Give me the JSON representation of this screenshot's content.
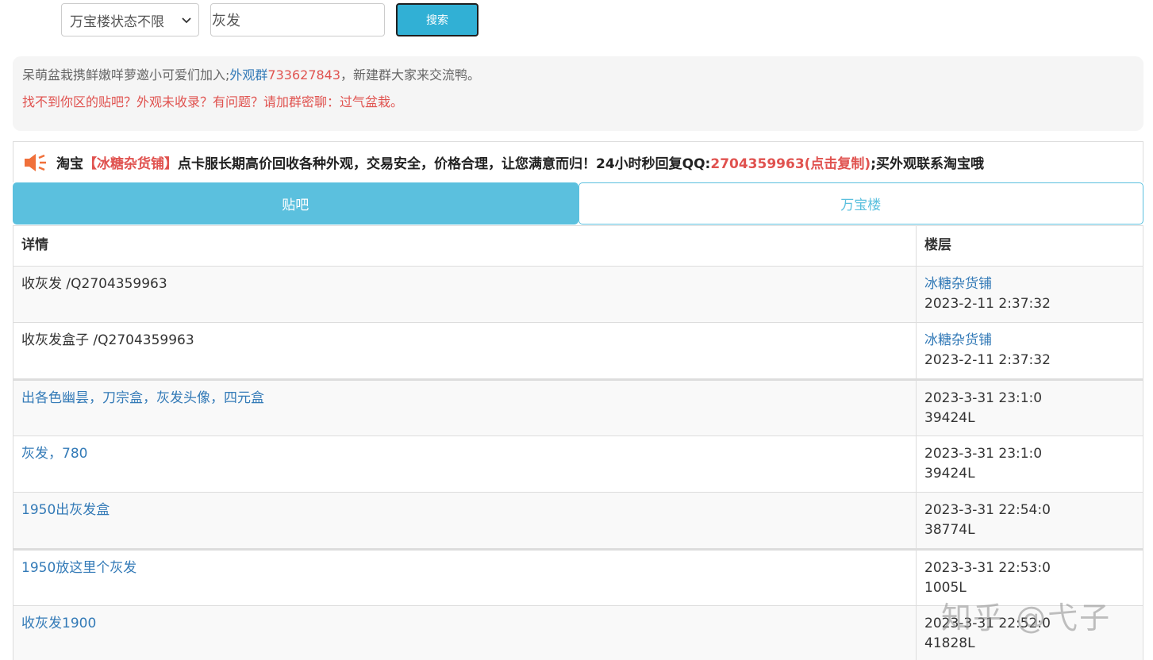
{
  "search": {
    "filter_selected": "万宝楼状态不限",
    "query_value": "灰发",
    "button_label": "搜索"
  },
  "notice": {
    "line1_prefix": "呆萌盆栽携鲜嫩咩萝邀小可爱们加入;",
    "line1_link": "外观群",
    "line1_number": "733627843",
    "line1_suffix": "，新建群大家来交流鸭。",
    "line2": "找不到你区的贴吧？外观未收录？有问题？请加群密聊：过气盆栽。"
  },
  "promo": {
    "icon": "speaker-icon",
    "prefix": "淘宝",
    "shop": "【冰糖杂货铺】",
    "middle": "点卡服长期高价回收各种外观，交易安全，价格合理，让您满意而归！24小时秒回复QQ:",
    "qq": "2704359963(点击复制)",
    "suffix": ";买外观联系淘宝哦"
  },
  "tabs": [
    {
      "label": "贴吧",
      "active": true
    },
    {
      "label": "万宝楼",
      "active": false
    }
  ],
  "table": {
    "headers": {
      "detail": "详情",
      "floor": "楼层"
    },
    "rows": [
      {
        "detail": "收灰发 /Q2704359963",
        "floor_line1": "冰糖杂货铺",
        "floor_line2": "2023-2-11 2:37:32"
      },
      {
        "detail": "收灰发盒子 /Q2704359963",
        "floor_line1": "冰糖杂货铺",
        "floor_line2": "2023-2-11 2:37:32"
      },
      {
        "detail": "出各色幽昙，刀宗盒，灰发头像，四元盒",
        "floor_line1": "2023-3-31 23:1:0",
        "floor_line2": "39424L"
      },
      {
        "detail": "灰发，780",
        "floor_line1": "2023-3-31 23:1:0",
        "floor_line2": "39424L"
      },
      {
        "detail": "1950出灰发盒",
        "floor_line1": "2023-3-31 22:54:0",
        "floor_line2": "38774L"
      },
      {
        "detail": "1950放这里个灰发",
        "floor_line1": "2023-3-31 22:53:0",
        "floor_line2": "1005L"
      },
      {
        "detail": "收灰发1900",
        "floor_line1": "2023-3-31 22:52:0",
        "floor_line2": "41828L"
      }
    ]
  },
  "watermark": "知乎 @弋子"
}
